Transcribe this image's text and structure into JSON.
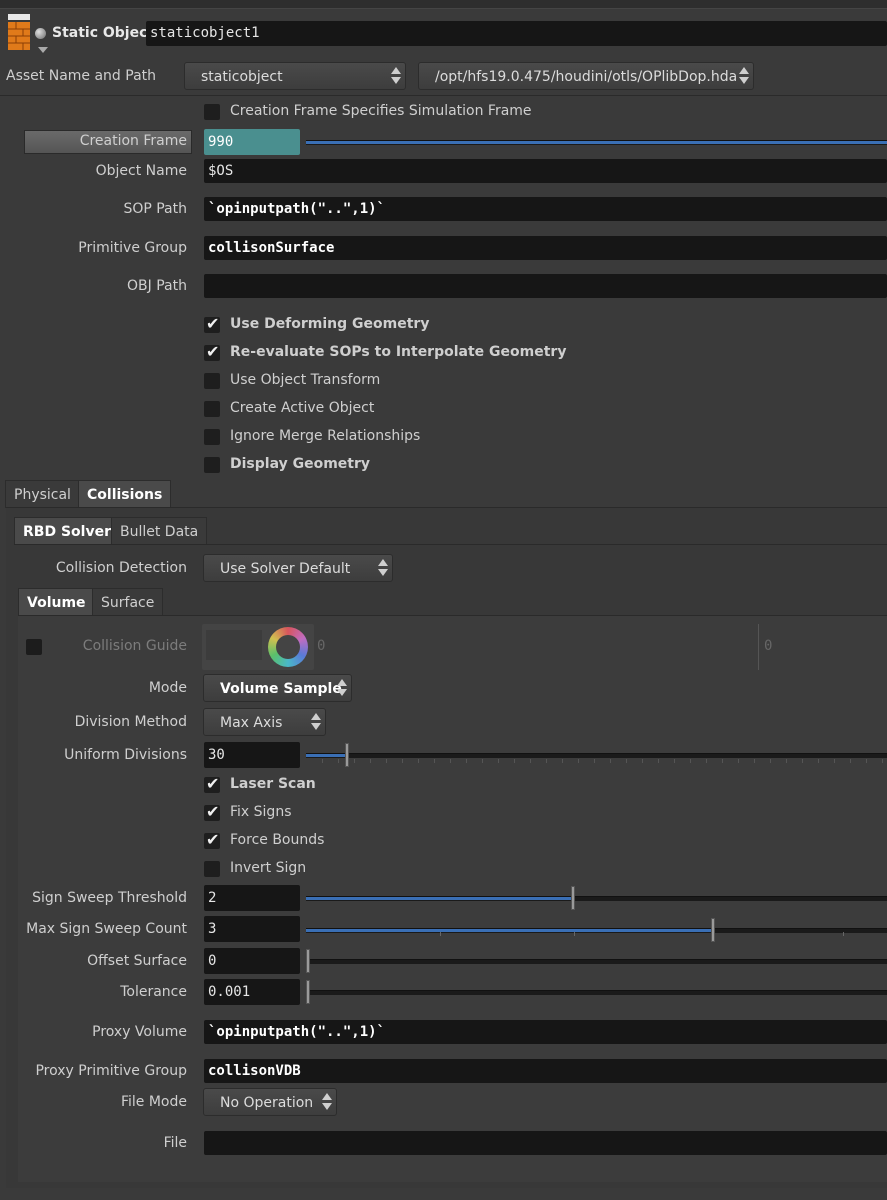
{
  "header": {
    "node_type": "Static Object",
    "node_name": "staticobject1"
  },
  "asset": {
    "label": "Asset Name and Path",
    "name": "staticobject",
    "path": "/opt/hfs19.0.475/houdini/otls/OPlibDop.hda"
  },
  "params": {
    "creation_frame_specifies": "Creation Frame Specifies Simulation Frame",
    "creation_frame_label": "Creation Frame",
    "creation_frame_value": "990",
    "object_name_label": "Object Name",
    "object_name_value": "$OS",
    "sop_path_label": "SOP Path",
    "sop_path_value": "`opinputpath(\"..\",1)`",
    "primitive_group_label": "Primitive Group",
    "primitive_group_value": "collisonSurface",
    "obj_path_label": "OBJ Path",
    "obj_path_value": ""
  },
  "toggles": [
    {
      "label": "Use Deforming Geometry",
      "checked": true,
      "bold": true
    },
    {
      "label": "Re-evaluate SOPs to Interpolate Geometry",
      "checked": true,
      "bold": true
    },
    {
      "label": "Use Object Transform",
      "checked": false,
      "bold": false
    },
    {
      "label": "Create Active Object",
      "checked": false,
      "bold": false
    },
    {
      "label": "Ignore Merge Relationships",
      "checked": false,
      "bold": false
    },
    {
      "label": "Display Geometry",
      "checked": false,
      "bold": true
    }
  ],
  "tabs_main": [
    "Physical",
    "Collisions"
  ],
  "tabs_solver": [
    "RBD Solver",
    "Bullet Data"
  ],
  "collision_detection": {
    "label": "Collision Detection",
    "value": "Use Solver Default"
  },
  "tabs_volume": [
    "Volume",
    "Surface"
  ],
  "volume": {
    "collision_guide_label": "Collision Guide",
    "guide_value_1": "0",
    "guide_value_2": "0",
    "mode_label": "Mode",
    "mode_value": "Volume Sample",
    "division_method_label": "Division Method",
    "division_method_value": "Max Axis",
    "uniform_divisions_label": "Uniform Divisions",
    "uniform_divisions_value": "30",
    "uniform_divisions_fraction": 0.07,
    "laser_scan": "Laser Scan",
    "fix_signs": "Fix Signs",
    "force_bounds": "Force Bounds",
    "invert_sign": "Invert Sign",
    "sign_sweep_threshold_label": "Sign Sweep Threshold",
    "sign_sweep_threshold_value": "2",
    "sign_sweep_threshold_fraction": 0.46,
    "max_sign_sweep_count_label": "Max Sign Sweep Count",
    "max_sign_sweep_count_value": "3",
    "max_sign_sweep_count_fraction": 0.7,
    "offset_surface_label": "Offset Surface",
    "offset_surface_value": "0",
    "tolerance_label": "Tolerance",
    "tolerance_value": "0.001",
    "proxy_volume_label": "Proxy Volume",
    "proxy_volume_value": "`opinputpath(\"..\",1)`",
    "proxy_primitive_group_label": "Proxy Primitive Group",
    "proxy_primitive_group_value": "collisonVDB",
    "file_mode_label": "File Mode",
    "file_mode_value": "No Operation",
    "file_label": "File",
    "file_value": ""
  },
  "colors": {
    "background": "#3a3a3a",
    "field": "#161616",
    "creation_frame_bg": "#4a8f8f",
    "slider_fill": "#3a6fb5"
  }
}
